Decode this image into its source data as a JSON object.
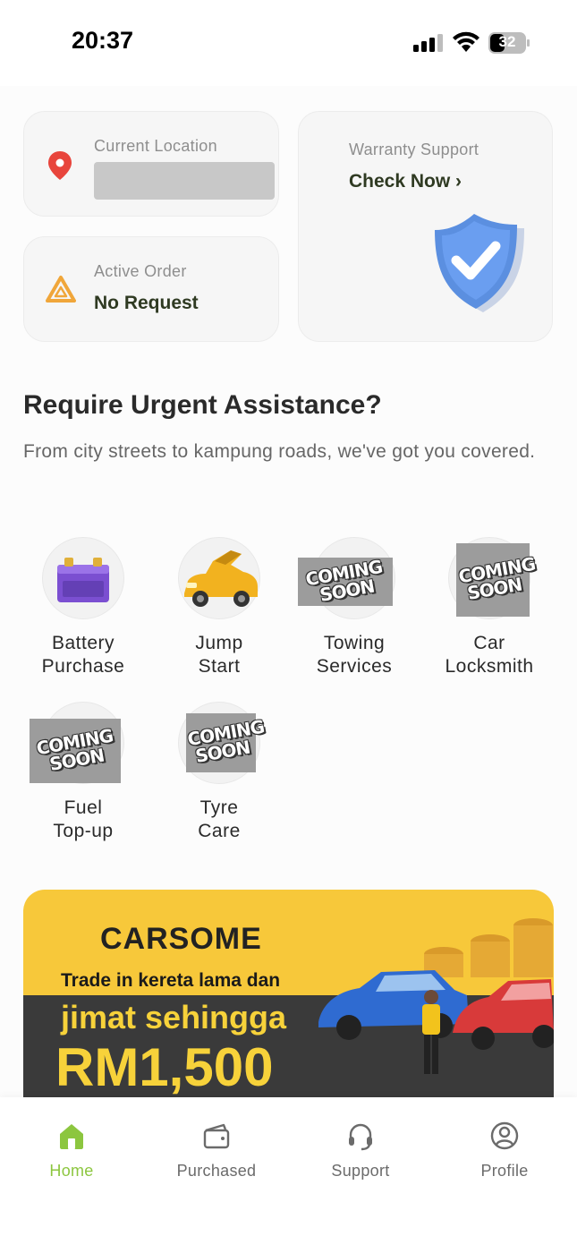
{
  "status_bar": {
    "time": "20:37",
    "battery": "32"
  },
  "location_card": {
    "label": "Current Location"
  },
  "order_card": {
    "label": "Active Order",
    "value": "No Request"
  },
  "warranty_card": {
    "label": "Warranty Support",
    "cta": "Check Now ›"
  },
  "assist": {
    "heading": "Require Urgent Assistance?",
    "subheading": "From city streets to kampung roads, we've got you covered."
  },
  "services": [
    {
      "line1": "Battery",
      "line2": "Purchase"
    },
    {
      "line1": "Jump",
      "line2": "Start"
    },
    {
      "line1": "Towing",
      "line2": "Services",
      "coming": "COMING SOON"
    },
    {
      "line1": "Car",
      "line2": "Locksmith",
      "coming": "COMING SOON"
    },
    {
      "line1": "Fuel",
      "line2": "Top-up",
      "coming": "COMING SOON"
    },
    {
      "line1": "Tyre",
      "line2": "Care",
      "coming": "COMING SOON"
    }
  ],
  "banner": {
    "brand": "CARSOME",
    "line1": "Trade in kereta lama dan",
    "line2": "jimat sehingga",
    "line3": "RM1,500"
  },
  "nav": [
    {
      "label": "Home",
      "icon": "home-icon",
      "active": true
    },
    {
      "label": "Purchased",
      "icon": "wallet-icon"
    },
    {
      "label": "Support",
      "icon": "headset-icon"
    },
    {
      "label": "Profile",
      "icon": "profile-icon"
    }
  ],
  "colors": {
    "accent": "#8cc63f",
    "location_pin": "#e8453c",
    "warning": "#f0a63a",
    "shield": "#5b8fe0",
    "banner_yellow": "#f7c83a"
  }
}
